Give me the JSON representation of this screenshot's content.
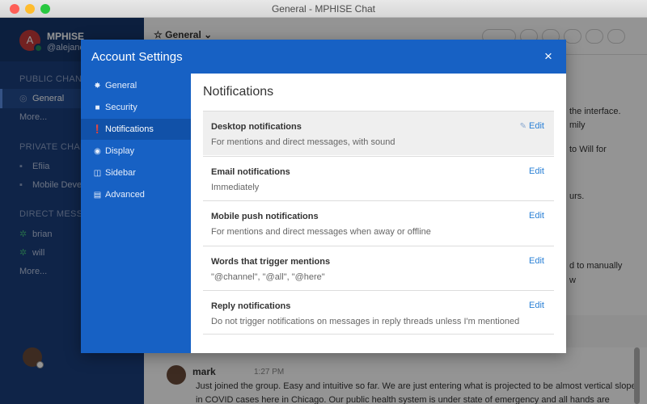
{
  "window": {
    "title": "General - MPHISE Chat"
  },
  "sidebar": {
    "avatar_initial": "A",
    "team_name": "MPHISE",
    "user_handle": "@alejand",
    "sections": {
      "public": "PUBLIC CHANN",
      "private": "PRIVATE CHAN",
      "direct": "DIRECT MESSAG"
    },
    "public_items": [
      "General",
      "More..."
    ],
    "private_items": [
      "Efiia",
      "Mobile Deve"
    ],
    "direct_items": [
      "brian",
      "will",
      "More..."
    ]
  },
  "chat": {
    "channel_title": "General",
    "fragments": [
      "the interface.",
      "mily",
      "to Will for",
      "urs.",
      "d to manually",
      "w"
    ],
    "last_message": {
      "author": "mark",
      "time": "1:27 PM",
      "text": "Just joined the group. Easy and intuitive so far. We are just entering what is projected to be almost vertical slope in COVID cases here in Chicago. Our public health system is under state of emergency and all hands are"
    }
  },
  "modal": {
    "title": "Account Settings",
    "close_label": "×",
    "nav": [
      {
        "label": "General",
        "icon": "gear-icon"
      },
      {
        "label": "Security",
        "icon": "lock-icon"
      },
      {
        "label": "Notifications",
        "icon": "alert-icon"
      },
      {
        "label": "Display",
        "icon": "eye-icon"
      },
      {
        "label": "Sidebar",
        "icon": "columns-icon"
      },
      {
        "label": "Advanced",
        "icon": "list-icon"
      }
    ],
    "active_nav": "Notifications",
    "content_title": "Notifications",
    "settings": [
      {
        "label": "Desktop notifications",
        "desc": "For mentions and direct messages, with sound",
        "edit": "Edit"
      },
      {
        "label": "Email notifications",
        "desc": "Immediately",
        "edit": "Edit"
      },
      {
        "label": "Mobile push notifications",
        "desc": "For mentions and direct messages when away or offline",
        "edit": "Edit"
      },
      {
        "label": "Words that trigger mentions",
        "desc": "\"@channel\", \"@all\", \"@here\"",
        "edit": "Edit"
      },
      {
        "label": "Reply notifications",
        "desc": "Do not trigger notifications on messages in reply threads unless I'm mentioned",
        "edit": "Edit"
      }
    ]
  },
  "colors": {
    "modal_accent": "#1761c4",
    "sidebar_bg": "#1b3f7d",
    "link": "#2a80d6"
  }
}
